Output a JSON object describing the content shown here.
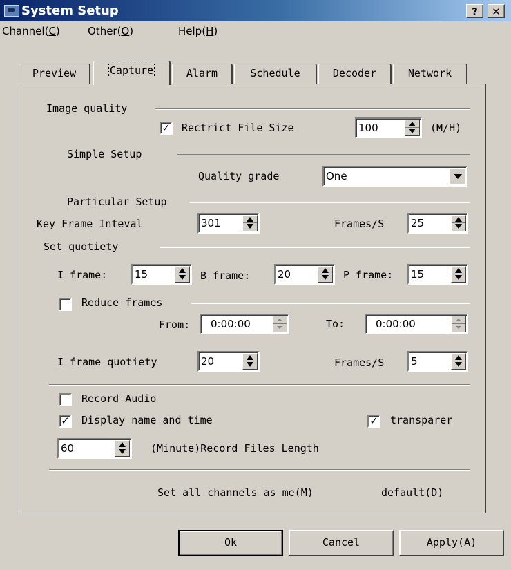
{
  "window": {
    "title": "System Setup",
    "help_button": "?",
    "close_button": "✕"
  },
  "menu": {
    "channel": {
      "text": "Channel(",
      "key": "C",
      "end": ")"
    },
    "other": {
      "text": "Other(",
      "key": "O",
      "end": ")"
    },
    "help": {
      "text": "Help(",
      "key": "H",
      "end": ")"
    }
  },
  "tabs": [
    "Preview",
    "Capture",
    "Alarm",
    "Schedule",
    "Decoder",
    "Network"
  ],
  "active_tab": "Capture",
  "capture": {
    "image_quality_label": "Image quality",
    "restrict_file_size": {
      "label": "Rectrict File Size",
      "checked": true,
      "value": "100",
      "unit": "(M/H)"
    },
    "simple_setup_label": "Simple Setup",
    "quality_grade": {
      "label": "Quality grade",
      "value": "One"
    },
    "particular_setup_label": "Particular Setup",
    "key_frame_interval": {
      "label": "Key Frame Inteval",
      "value": "301"
    },
    "frames_per_sec_1": {
      "label": "Frames/S",
      "value": "25"
    },
    "set_quotiety_label": "Set quotiety",
    "i_frame": {
      "label": "I frame:",
      "value": "15"
    },
    "b_frame": {
      "label": "B frame:",
      "value": "20"
    },
    "p_frame": {
      "label": "P frame:",
      "value": "15"
    },
    "reduce_frames": {
      "label": "Reduce frames",
      "checked": false
    },
    "from": {
      "label": "From:",
      "value": "0:00:00"
    },
    "to": {
      "label": "To:",
      "value": "0:00:00"
    },
    "i_frame_quotiety": {
      "label": "I frame quotiety",
      "value": "20"
    },
    "frames_per_sec_2": {
      "label": "Frames/S",
      "value": "5"
    },
    "record_audio": {
      "label": "Record Audio",
      "checked": false
    },
    "display_name_time": {
      "label": "Display name and time",
      "checked": true
    },
    "transparent": {
      "label": "transparer",
      "checked": true
    },
    "record_length": {
      "value": "60",
      "label": "(Minute)Record Files Length"
    },
    "set_all_channels": {
      "text": "Set all channels as me(",
      "key": "M",
      "end": ")"
    },
    "default": {
      "text": "default(",
      "key": "D",
      "end": ")"
    }
  },
  "buttons": {
    "ok": "Ok",
    "cancel": "Cancel",
    "apply": {
      "text": "Apply(",
      "key": "A",
      "end": ")"
    }
  },
  "colors": {
    "titlebar_start": "#0a246a",
    "titlebar_end": "#a6caf0",
    "face": "#d4d0c8"
  }
}
